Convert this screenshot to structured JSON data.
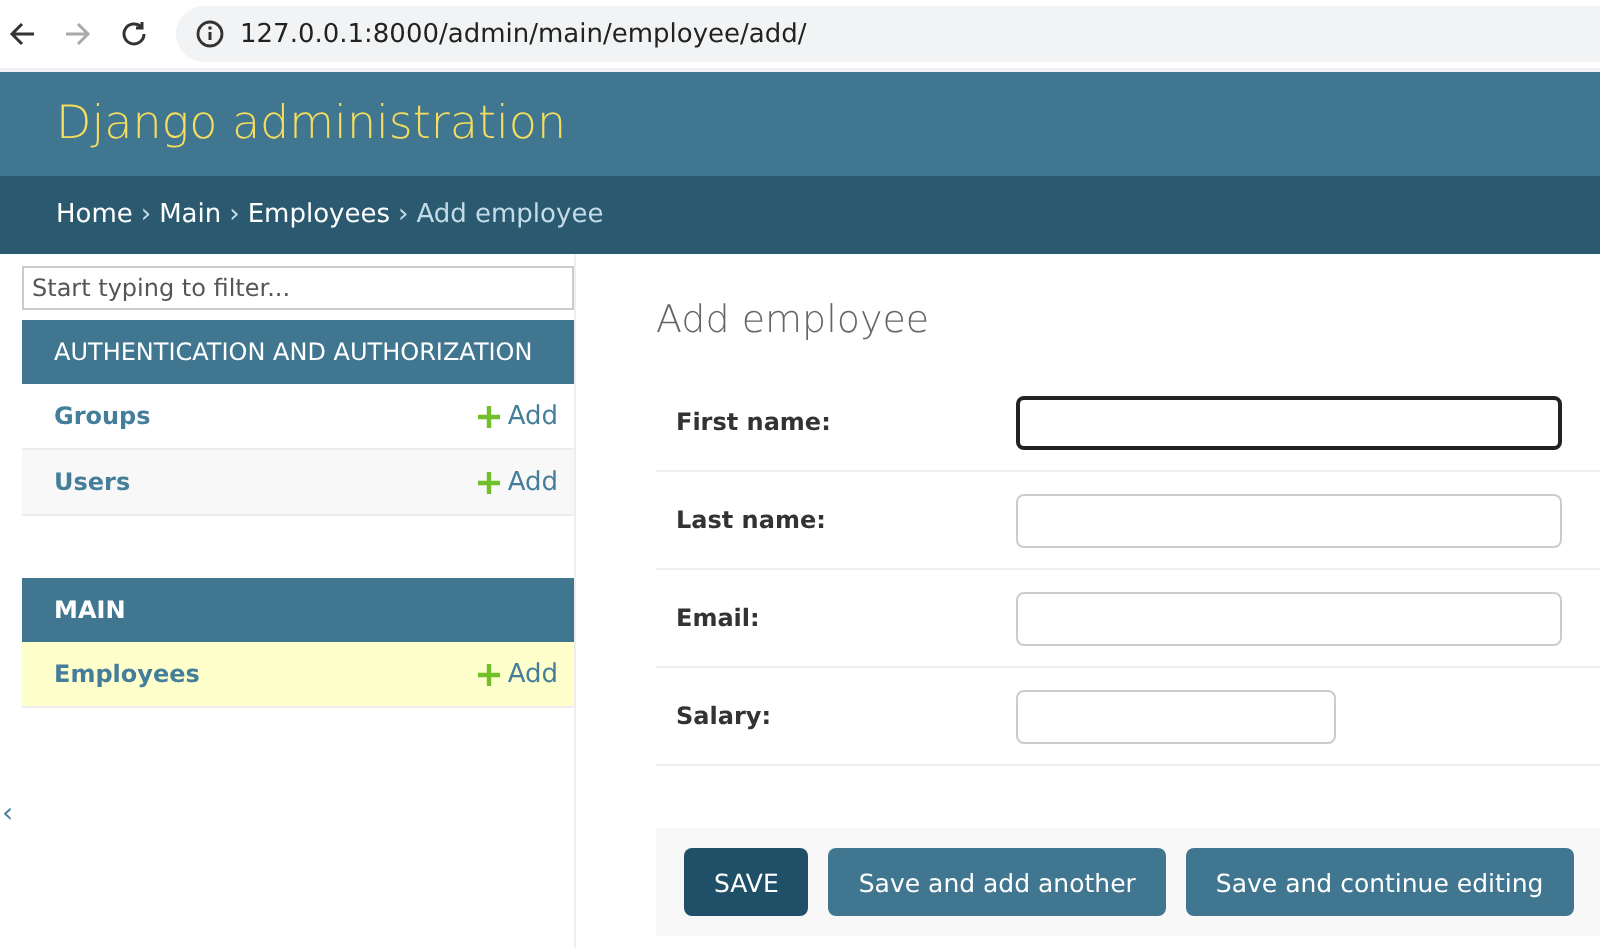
{
  "browser": {
    "url": "127.0.0.1:8000/admin/main/employee/add/"
  },
  "header": {
    "title": "Django administration"
  },
  "breadcrumb_separator": "›",
  "breadcrumbs": [
    {
      "label": "Home",
      "current": false
    },
    {
      "label": "Main",
      "current": false
    },
    {
      "label": "Employees",
      "current": false
    },
    {
      "label": "Add employee",
      "current": true
    }
  ],
  "sidebar": {
    "filter": {
      "placeholder": "Start typing to filter..."
    },
    "toggle": "‹",
    "apps": [
      {
        "name": "AUTHENTICATION AND AUTHORIZATION",
        "models": [
          {
            "name": "Groups",
            "add": "Add",
            "selected": false
          },
          {
            "name": "Users",
            "add": "Add",
            "selected": false
          }
        ]
      },
      {
        "name": "MAIN",
        "models": [
          {
            "name": "Employees",
            "add": "Add",
            "selected": true
          }
        ]
      }
    ]
  },
  "content": {
    "title": "Add employee",
    "fields": [
      {
        "label": "First name:",
        "kind": "text",
        "focused": true
      },
      {
        "label": "Last name:",
        "kind": "text",
        "focused": false
      },
      {
        "label": "Email:",
        "kind": "text",
        "focused": false
      },
      {
        "label": "Salary:",
        "kind": "number",
        "focused": false
      }
    ],
    "buttons": [
      {
        "label": "SAVE",
        "kind": "default"
      },
      {
        "label": "Save and add another",
        "kind": "secondary"
      },
      {
        "label": "Save and continue editing",
        "kind": "secondary"
      }
    ]
  }
}
